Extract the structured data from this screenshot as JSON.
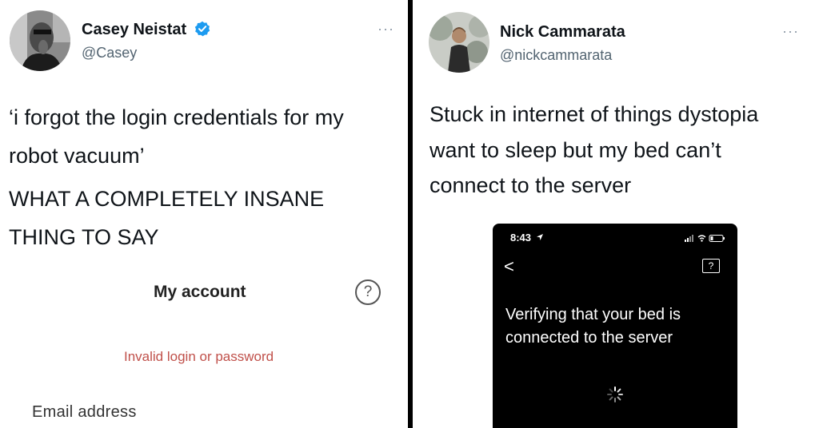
{
  "left_tweet": {
    "author_name": "Casey Neistat",
    "author_handle": "@Casey",
    "more_label": "···",
    "text_lines": [
      "‘i forgot the login credentials for my",
      "robot vacuum’",
      "WHAT A COMPLETELY INSANE",
      "THING TO SAY"
    ],
    "embedded_screen": {
      "title": "My account",
      "help_label": "?",
      "error": "Invalid login or password",
      "email_label": "Email address"
    }
  },
  "right_tweet": {
    "author_name": "Nick Cammarata",
    "author_handle": "@nickcammarata",
    "more_label": "···",
    "text_lines": [
      "Stuck in internet of things dystopia",
      "want to sleep but my bed can’t",
      "connect to the server"
    ],
    "embedded_screen": {
      "status_time": "8:43",
      "back_label": "<",
      "help_label": "?",
      "message_lines": [
        "Verifying that your bed is",
        "connected to the server"
      ]
    }
  },
  "colors": {
    "verified_badge": "#1d9bf0",
    "error_text": "#c0504a",
    "handle_text": "#536471"
  }
}
